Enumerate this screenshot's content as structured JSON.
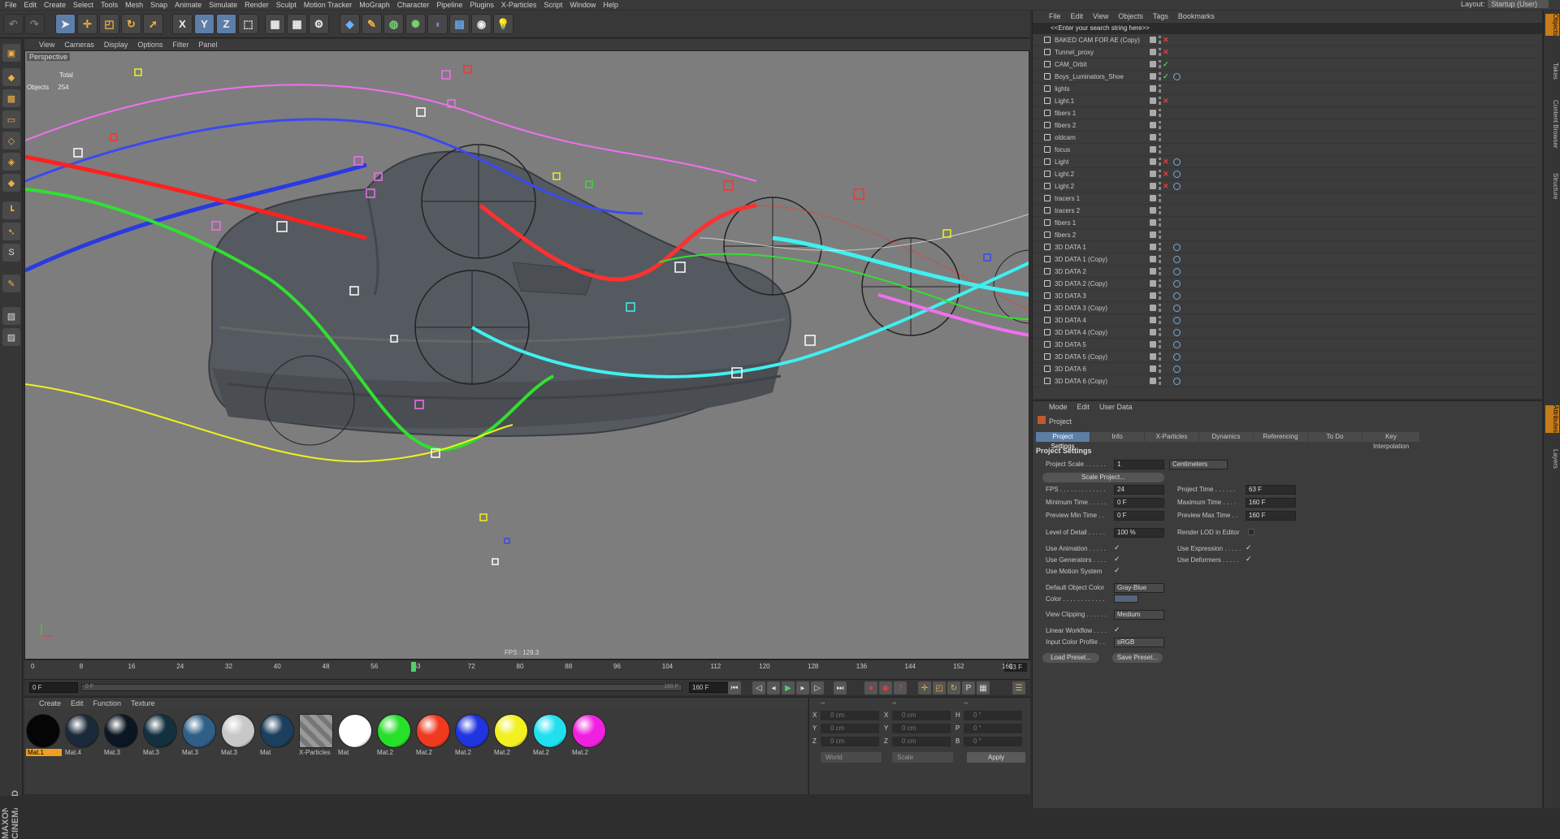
{
  "menubar": [
    "File",
    "Edit",
    "Create",
    "Select",
    "Tools",
    "Mesh",
    "Snap",
    "Animate",
    "Simulate",
    "Render",
    "Sculpt",
    "Motion Tracker",
    "MoGraph",
    "Character",
    "Pipeline",
    "Plugins",
    "X-Particles",
    "Script",
    "Window",
    "Help"
  ],
  "layout": {
    "label": "Layout:",
    "value": "Startup (User)"
  },
  "viewport": {
    "menu": [
      "View",
      "Cameras",
      "Display",
      "Options",
      "Filter",
      "Panel"
    ],
    "camera": "Perspective",
    "stats_total_label": "Total",
    "stats_objects_label": "Objects",
    "stats_objects_value": "254",
    "fps": "FPS : 129.3"
  },
  "timeline": {
    "ticks": [
      "0",
      "8",
      "16",
      "24",
      "32",
      "40",
      "48",
      "56",
      "63",
      "72",
      "80",
      "88",
      "96",
      "104",
      "112",
      "120",
      "128",
      "136",
      "144",
      "152",
      "160"
    ],
    "current_frame": "63 F",
    "playhead_frame": 63,
    "max_frame": 160,
    "start_field": "0 F",
    "range_start": "0 F",
    "range_end": "160 F",
    "end_field": "160 F"
  },
  "material_manager": {
    "menu": [
      "Create",
      "Edit",
      "Function",
      "Texture"
    ],
    "materials": [
      {
        "label": "Mat.1",
        "color": "#050505",
        "active": true
      },
      {
        "label": "Mat.4",
        "color": "#1a2a3a"
      },
      {
        "label": "Mat.3",
        "color": "#0b1622"
      },
      {
        "label": "Mat.3",
        "color": "#13303f"
      },
      {
        "label": "Mat.3",
        "color": "#2f5f86"
      },
      {
        "label": "Mat.3",
        "color": "#c8c8c8"
      },
      {
        "label": "Mat",
        "color": "#1b3f5c"
      },
      {
        "label": "X-Particles",
        "color": "#8a8a8a"
      },
      {
        "label": "Mat",
        "color": "#ffffff"
      },
      {
        "label": "Mat.2",
        "color": "#26e02a"
      },
      {
        "label": "Mat.2",
        "color": "#f03a20"
      },
      {
        "label": "Mat.2",
        "color": "#2034e0"
      },
      {
        "label": "Mat.2",
        "color": "#f2f020"
      },
      {
        "label": "Mat.2",
        "color": "#20e0f0"
      },
      {
        "label": "Mat.2",
        "color": "#f020e0"
      }
    ]
  },
  "coordinates": {
    "header1": "--",
    "header2": "--",
    "header3": "--",
    "rows": [
      {
        "a": "X",
        "av": "0 cm",
        "b": "X",
        "bv": "0 cm",
        "c": "H",
        "cv": "0 °"
      },
      {
        "a": "Y",
        "av": "0 cm",
        "b": "Y",
        "bv": "0 cm",
        "c": "P",
        "cv": "0 °"
      },
      {
        "a": "Z",
        "av": "0 cm",
        "b": "Z",
        "bv": "0 cm",
        "c": "B",
        "cv": "0 °"
      }
    ],
    "world": "World",
    "scale": "Scale",
    "apply": "Apply"
  },
  "object_manager": {
    "menu": [
      "File",
      "Edit",
      "View",
      "Objects",
      "Tags",
      "Bookmarks"
    ],
    "search_placeholder": "<<Enter your search string here>>",
    "objects": [
      {
        "name": "BAKED CAM FOR AE (Copy)",
        "flag": "✕",
        "flagc": "#e04040",
        "tag": false
      },
      {
        "name": "Tunnel_proxy",
        "flag": "✕",
        "flagc": "#e04040",
        "tag": false
      },
      {
        "name": "CAM_Orbit",
        "flag": "✓",
        "flagc": "#50d050",
        "tag": false
      },
      {
        "name": "Boys_Luminators_Shoe",
        "flag": "✓",
        "flagc": "#50d050",
        "tag": true
      },
      {
        "name": "lights",
        "flag": "",
        "flagc": "#e04040",
        "tag": false
      },
      {
        "name": "Light.1",
        "flag": "✕",
        "flagc": "#e04040",
        "tag": false
      },
      {
        "name": "fibers 1",
        "flag": "",
        "flagc": "#e04040",
        "tag": false
      },
      {
        "name": "fibers 2",
        "flag": "",
        "flagc": "#e04040",
        "tag": false
      },
      {
        "name": "oldcam",
        "flag": "",
        "flagc": "#e04040",
        "tag": false
      },
      {
        "name": "focus",
        "flag": "",
        "flagc": "#e04040",
        "tag": false
      },
      {
        "name": "Light",
        "flag": "✕",
        "flagc": "#e04040",
        "tag": true
      },
      {
        "name": "Light.2",
        "flag": "✕",
        "flagc": "#e04040",
        "tag": true
      },
      {
        "name": "Light.2",
        "flag": "✕",
        "flagc": "#e04040",
        "tag": true
      },
      {
        "name": "tracers 1",
        "flag": "",
        "flagc": "#e04040",
        "tag": false
      },
      {
        "name": "tracers 2",
        "flag": "",
        "flagc": "#e04040",
        "tag": false
      },
      {
        "name": "fibers 1",
        "flag": "",
        "flagc": "#e04040",
        "tag": false
      },
      {
        "name": "fibers 2",
        "flag": "",
        "flagc": "#e04040",
        "tag": false
      },
      {
        "name": "3D DATA 1",
        "flag": "",
        "flagc": "#e04040",
        "tag": true
      },
      {
        "name": "3D DATA 1 (Copy)",
        "flag": "",
        "flagc": "#e04040",
        "tag": true
      },
      {
        "name": "3D DATA 2",
        "flag": "",
        "flagc": "#e04040",
        "tag": true
      },
      {
        "name": "3D DATA 2 (Copy)",
        "flag": "",
        "flagc": "#e04040",
        "tag": true
      },
      {
        "name": "3D DATA 3",
        "flag": "",
        "flagc": "#e04040",
        "tag": true
      },
      {
        "name": "3D DATA 3 (Copy)",
        "flag": "",
        "flagc": "#e04040",
        "tag": true
      },
      {
        "name": "3D DATA 4",
        "flag": "",
        "flagc": "#e04040",
        "tag": true
      },
      {
        "name": "3D DATA 4 (Copy)",
        "flag": "",
        "flagc": "#e04040",
        "tag": true
      },
      {
        "name": "3D DATA 5",
        "flag": "",
        "flagc": "#e04040",
        "tag": true
      },
      {
        "name": "3D DATA 5 (Copy)",
        "flag": "",
        "flagc": "#e04040",
        "tag": true
      },
      {
        "name": "3D DATA 6",
        "flag": "",
        "flagc": "#e04040",
        "tag": true
      },
      {
        "name": "3D DATA 6 (Copy)",
        "flag": "",
        "flagc": "#e04040",
        "tag": true
      }
    ]
  },
  "right_tabs": [
    "Objects",
    "Takes",
    "Content Browser",
    "Structure",
    "Attributes",
    "Layers"
  ],
  "attributes": {
    "menu": [
      "Mode",
      "Edit",
      "User Data"
    ],
    "title": "Project",
    "tabs": [
      "Project Settings",
      "Info",
      "X-Particles",
      "Dynamics",
      "Referencing",
      "To Do",
      "Key Interpolation"
    ],
    "section": "Project Settings",
    "project_scale_label": "Project Scale . . . . . .",
    "project_scale": "1",
    "project_scale_unit": "Centimeters",
    "scale_project_btn": "Scale Project...",
    "fps_label": "FPS . . . . . . . . . . . . .",
    "fps": "24",
    "project_time_label": "Project Time . . . . . .",
    "project_time": "63 F",
    "min_time_label": "Minimum Time . . . . .",
    "min_time": "0 F",
    "max_time_label": "Maximum Time . . . .",
    "max_time": "160 F",
    "prev_min_label": "Preview Min Time . .",
    "prev_min": "0 F",
    "prev_max_label": "Preview Max Time . .",
    "prev_max": "160 F",
    "lod_label": "Level of Detail . . . . .",
    "lod": "100 %",
    "render_lod_label": "Render LOD in Editor",
    "use_anim_label": "Use Animation . . . . .",
    "use_expr_label": "Use Expression . . . . .",
    "use_gen_label": "Use Generators . . . .",
    "use_def_label": "Use Deformers . . . . .",
    "use_motion_label": "Use Motion System",
    "default_color_label": "Default Object Color",
    "default_color": "Gray-Blue",
    "color_label": "Color . . . . . . . . . . . .",
    "view_clip_label": "View Clipping . . . . . .",
    "view_clip": "Medium",
    "linear_label": "Linear Workflow . . . .",
    "input_profile_label": "Input Color Profile . .",
    "input_profile": "sRGB",
    "load_preset": "Load Preset...",
    "save_preset": "Save Preset...",
    "check": "✓"
  }
}
